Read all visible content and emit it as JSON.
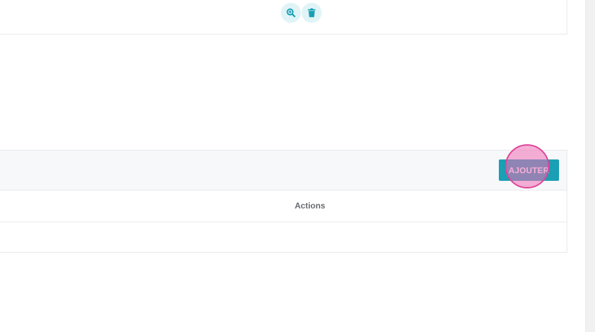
{
  "top_card": {
    "actions": [
      {
        "icon": "zoom-in-icon",
        "color": "#1a9fb4"
      },
      {
        "icon": "trash-icon",
        "color": "#1a9fb4"
      }
    ]
  },
  "card": {
    "add_button_label": "AJOUTER",
    "table": {
      "columns": [
        "Actions"
      ],
      "rows": []
    }
  },
  "colors": {
    "accent": "#1a9fb4",
    "icon_bg": "#e0f4f7",
    "header_bg": "#f7f8fa",
    "border": "#e6e9ec",
    "click_marker": "#e0449a"
  }
}
